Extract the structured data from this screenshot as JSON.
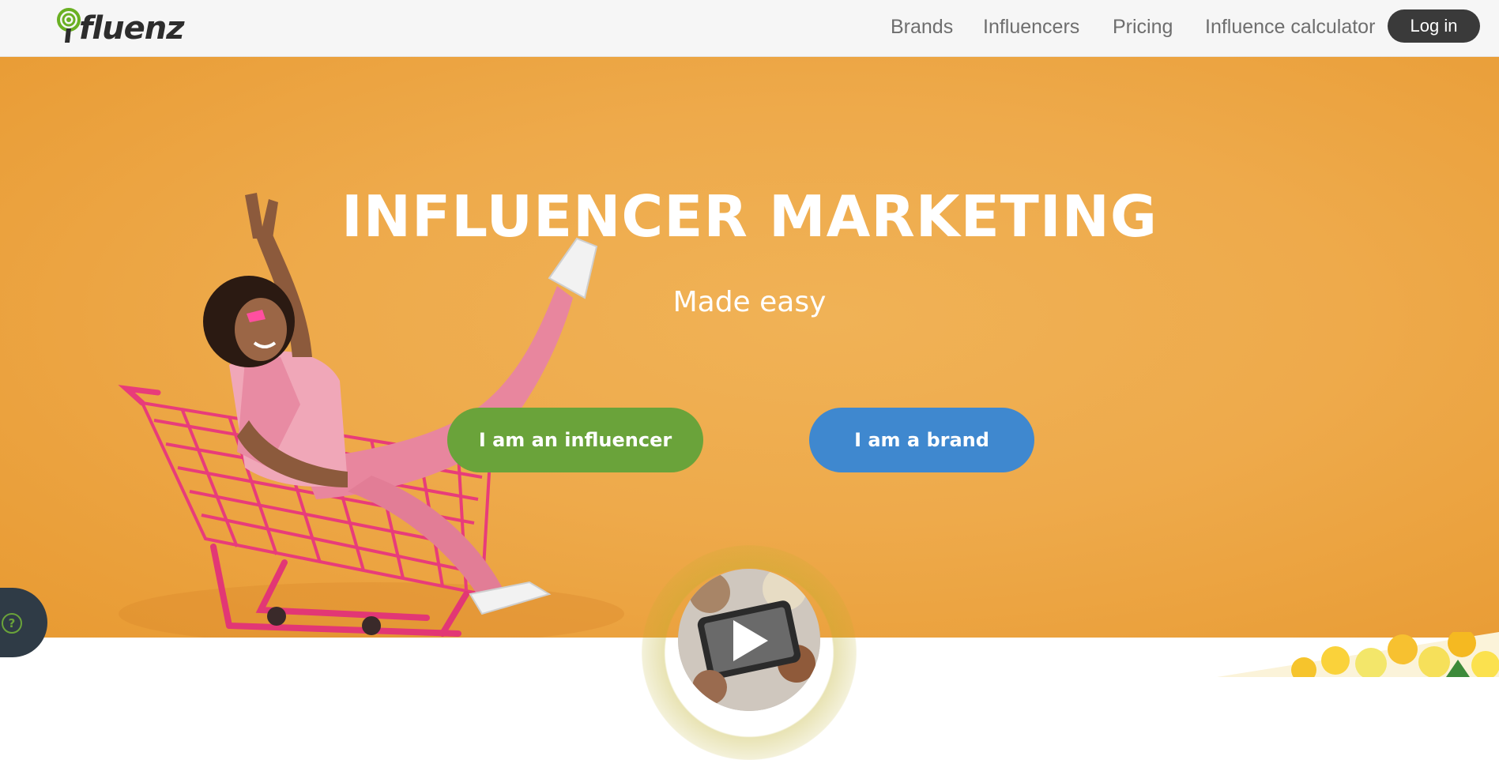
{
  "header": {
    "logo_text": "fluenz",
    "nav": [
      {
        "label": "Brands"
      },
      {
        "label": "Influencers"
      },
      {
        "label": "Pricing"
      },
      {
        "label": "Influence calculator"
      }
    ],
    "login_label": "Log in"
  },
  "hero": {
    "title": "INFLUENCER MARKETING",
    "subtitle": "Made easy",
    "cta_influencer": "I am an influencer",
    "cta_brand": "I am a brand"
  },
  "help": {
    "icon": "question-icon",
    "glyph": "?"
  },
  "colors": {
    "hero_orange": "#eeaa4b",
    "influencer_green": "#6aa33a",
    "brand_blue": "#3f88cf",
    "login_dark": "#3a3a3a",
    "logo_green": "#6ab023"
  }
}
